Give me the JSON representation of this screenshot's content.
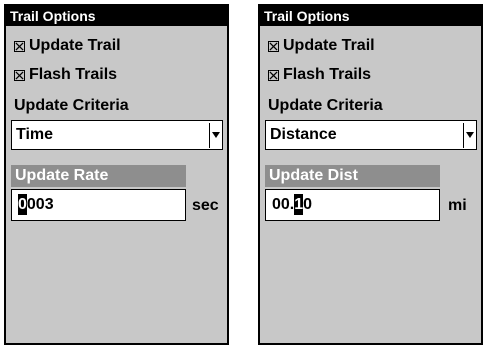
{
  "left_panel": {
    "title": "Trail Options",
    "update_trail": {
      "label": "Update Trail",
      "checked": true
    },
    "flash_trails": {
      "label": "Flash Trails",
      "checked": true
    },
    "criteria_label": "Update Criteria",
    "criteria_value": "Time",
    "field_label": "Update Rate",
    "field_value_cursor": "0",
    "field_value_rest": "003",
    "unit": "sec"
  },
  "right_panel": {
    "title": "Trail Options",
    "update_trail": {
      "label": "Update Trail",
      "checked": true
    },
    "flash_trails": {
      "label": "Flash Trails",
      "checked": true
    },
    "criteria_label": "Update Criteria",
    "criteria_value": "Distance",
    "field_label": "Update Dist",
    "field_value_before": "00.",
    "field_value_cursor": "1",
    "field_value_after": "0",
    "unit": "mi"
  },
  "colors": {
    "panel_bg": "#c8c8c8",
    "title_bg": "#000000",
    "field_header_bg": "#8e8e8e",
    "input_bg": "#ffffff"
  },
  "icons": {
    "checkbox": "checked-box-icon",
    "dropdown": "dropdown-arrow-icon"
  }
}
